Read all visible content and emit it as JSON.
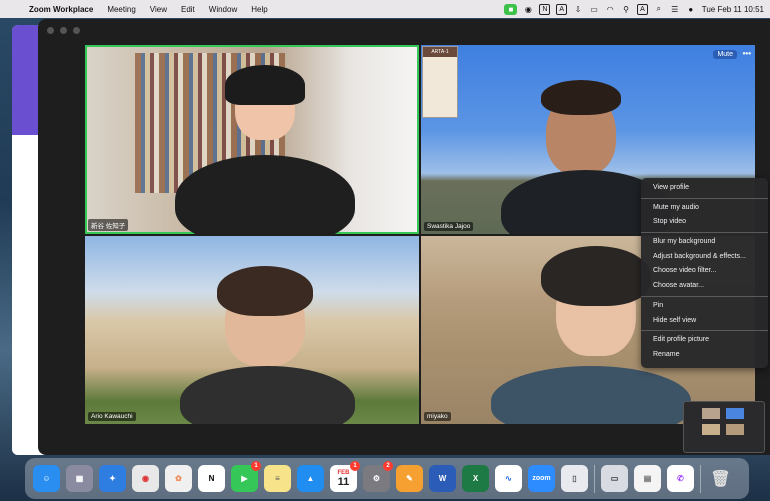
{
  "menubar": {
    "app_name": "Zoom Workplace",
    "menus": [
      "Meeting",
      "View",
      "Edit",
      "Window",
      "Help"
    ],
    "clock": "Tue Feb 11  10:51",
    "input_source": "A"
  },
  "participants": [
    {
      "name": "新谷 佐知子",
      "active_speaker": true
    },
    {
      "name": "Swastika Jajoo",
      "active_speaker": false
    },
    {
      "name": "Ario Kawauchi",
      "active_speaker": false
    },
    {
      "name": "miyako",
      "active_speaker": false
    }
  ],
  "tile_controls": {
    "mute_label": "Mute",
    "more_label": "•••",
    "poster_title": "ARTA-1"
  },
  "context_menu": {
    "group1": [
      "View profile"
    ],
    "group2": [
      "Mute my audio",
      "Stop video"
    ],
    "group3": [
      "Blur my background",
      "Adjust background & effects...",
      "Choose video filter...",
      "Choose avatar..."
    ],
    "group4": [
      "Pin",
      "Hide self view"
    ],
    "group5": [
      "Edit profile picture",
      "Rename"
    ]
  },
  "dock": {
    "calendar_month": "FEB",
    "calendar_day": "11",
    "facetime_badge": "1",
    "calendar_badge": "1",
    "settings_badge": "2",
    "zoom_label": "zoom"
  },
  "colors": {
    "active_speaker_border": "#35c758",
    "menu_bg": "#28282a",
    "zoom_bg": "#1e1e1f"
  }
}
